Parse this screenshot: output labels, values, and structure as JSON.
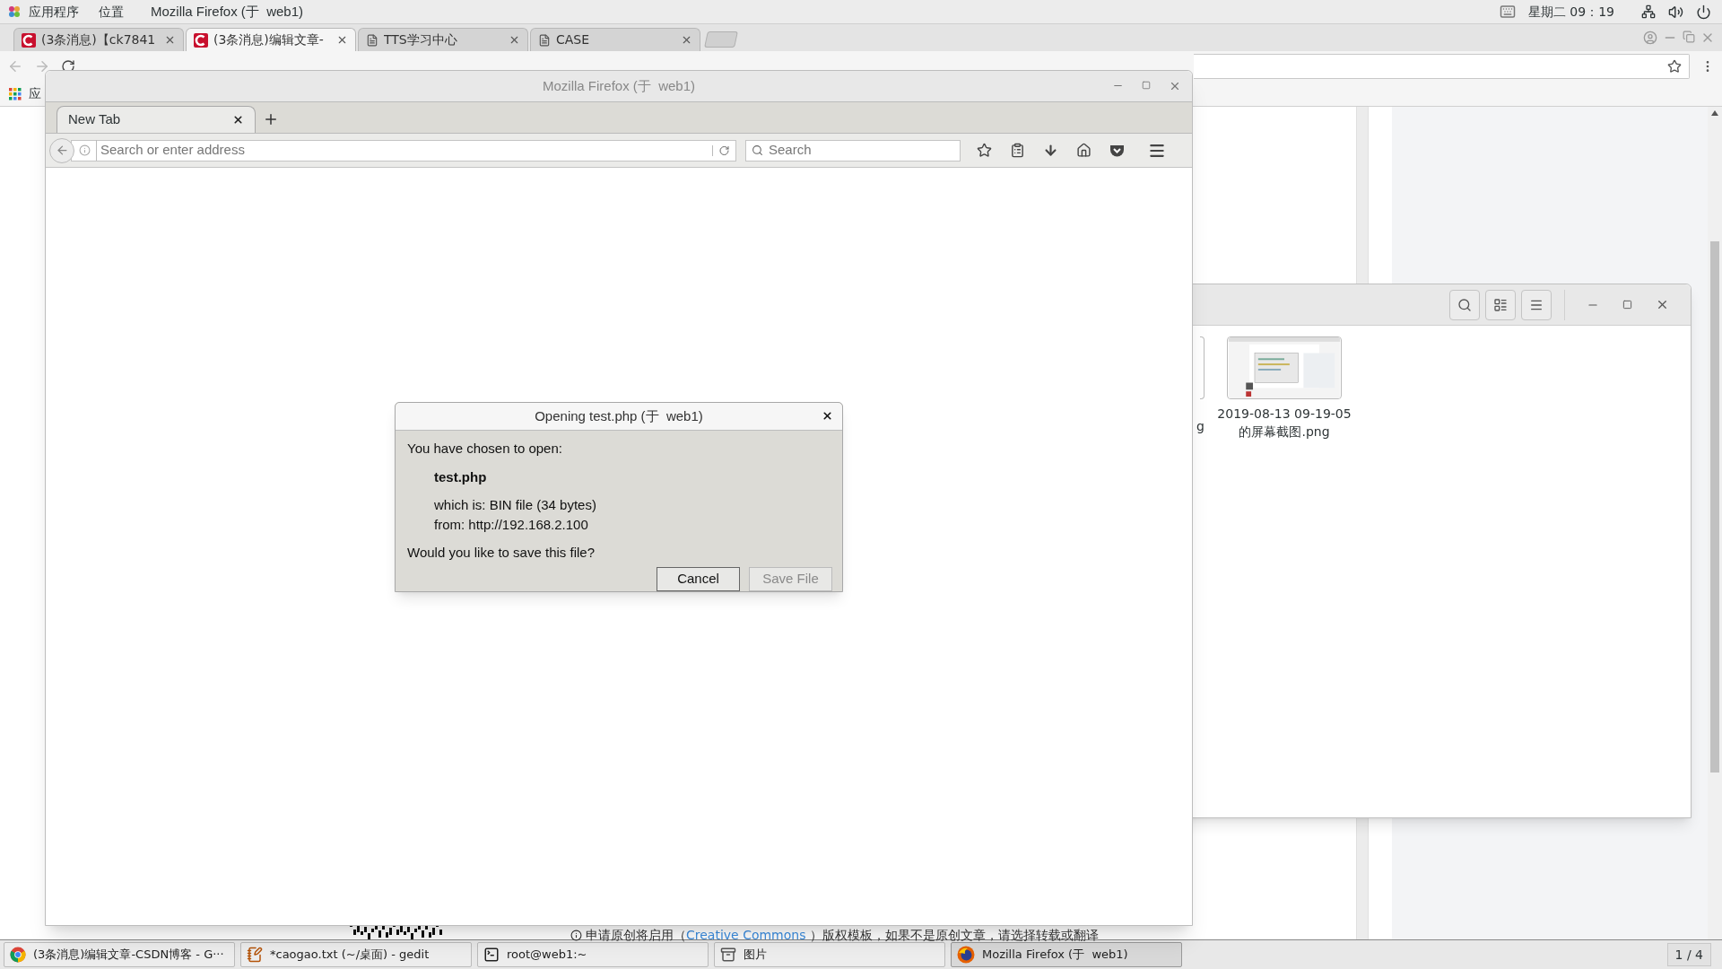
{
  "top_panel": {
    "menus": [
      "应用程序",
      "位置"
    ],
    "app_title": "Mozilla Firefox (于  web1)",
    "clock": "星期二 09：19"
  },
  "chrome": {
    "tabs": [
      {
        "title": "(3条消息)【ck7841",
        "kind": "csdn",
        "selected": false
      },
      {
        "title": "(3条消息)编辑文章-",
        "kind": "csdn",
        "selected": true
      },
      {
        "title": "TTS学习中心",
        "kind": "page",
        "selected": false
      },
      {
        "title": "CASE",
        "kind": "page",
        "selected": false
      }
    ],
    "bookmark": "应",
    "footer_notice": {
      "before": "申请原创将启用（",
      "link": "Creative Commons",
      "after": " ）版权模板，如果不是原创文章，请选择转载或翻译"
    }
  },
  "firefox": {
    "title": "Mozilla Firefox (于  web1)",
    "tabs": [
      {
        "label": "New Tab",
        "selected": true
      }
    ],
    "address_placeholder": "Search or enter address",
    "search_placeholder": "Search"
  },
  "dialog": {
    "title": "Opening test.php (于  web1)",
    "intro": "You have chosen to open:",
    "file_name": "test.php",
    "file_type": "which is: BIN file (34 bytes)",
    "source": "from: http://192.168.2.100",
    "question": "Would you like to save this file?",
    "buttons": [
      {
        "label": "Cancel",
        "disabled": false
      },
      {
        "label": "Save File",
        "disabled": true
      }
    ]
  },
  "file_manager": {
    "items": [
      {
        "name": "g",
        "kind": "partial"
      },
      {
        "name": "2019-08-13 09-19-05 的屏幕截图.png",
        "kind": "picture"
      }
    ]
  },
  "taskbar": {
    "items": [
      {
        "label": "(3条消息)编辑文章-CSDN博客 - G···",
        "kind": "chrome",
        "selected": false
      },
      {
        "label": "*caogao.txt (~/桌面) - gedit",
        "kind": "editor",
        "selected": false
      },
      {
        "label": "root@web1:~",
        "kind": "terminal",
        "selected": false
      },
      {
        "label": "图片",
        "kind": "files",
        "selected": false
      },
      {
        "label": "Mozilla Firefox (于  web1)",
        "kind": "firefox",
        "selected": true
      }
    ],
    "workspace": "1 / 4"
  }
}
